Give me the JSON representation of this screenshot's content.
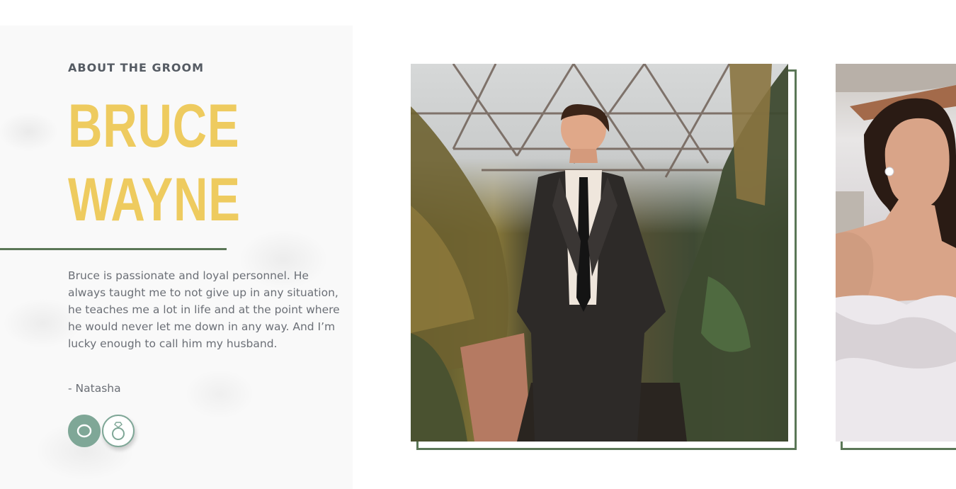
{
  "about": {
    "eyebrow": "ABOUT THE GROOM",
    "name_line1": "BRUCE",
    "name_line2": "WAYNE",
    "bio": "Bruce is passionate and loyal personnel. He always taught me to not give up in any situation, he teaches me a lot in life and at the point where he would never let me down in any way. And I’m lucky enough to call him my husband.",
    "signature": "- Natasha"
  },
  "nav": {
    "buttons": [
      {
        "icon": "ring-outline-icon",
        "state": "active"
      },
      {
        "icon": "diamond-ring-icon",
        "state": "inactive"
      }
    ]
  },
  "photos": [
    {
      "subject": "groom-photo"
    },
    {
      "subject": "bride-photo"
    }
  ],
  "colors": {
    "accent_gold": "#eecb5f",
    "accent_green": "#5b7757",
    "button_teal": "#7fa797",
    "text_gray": "#6b6f76"
  }
}
